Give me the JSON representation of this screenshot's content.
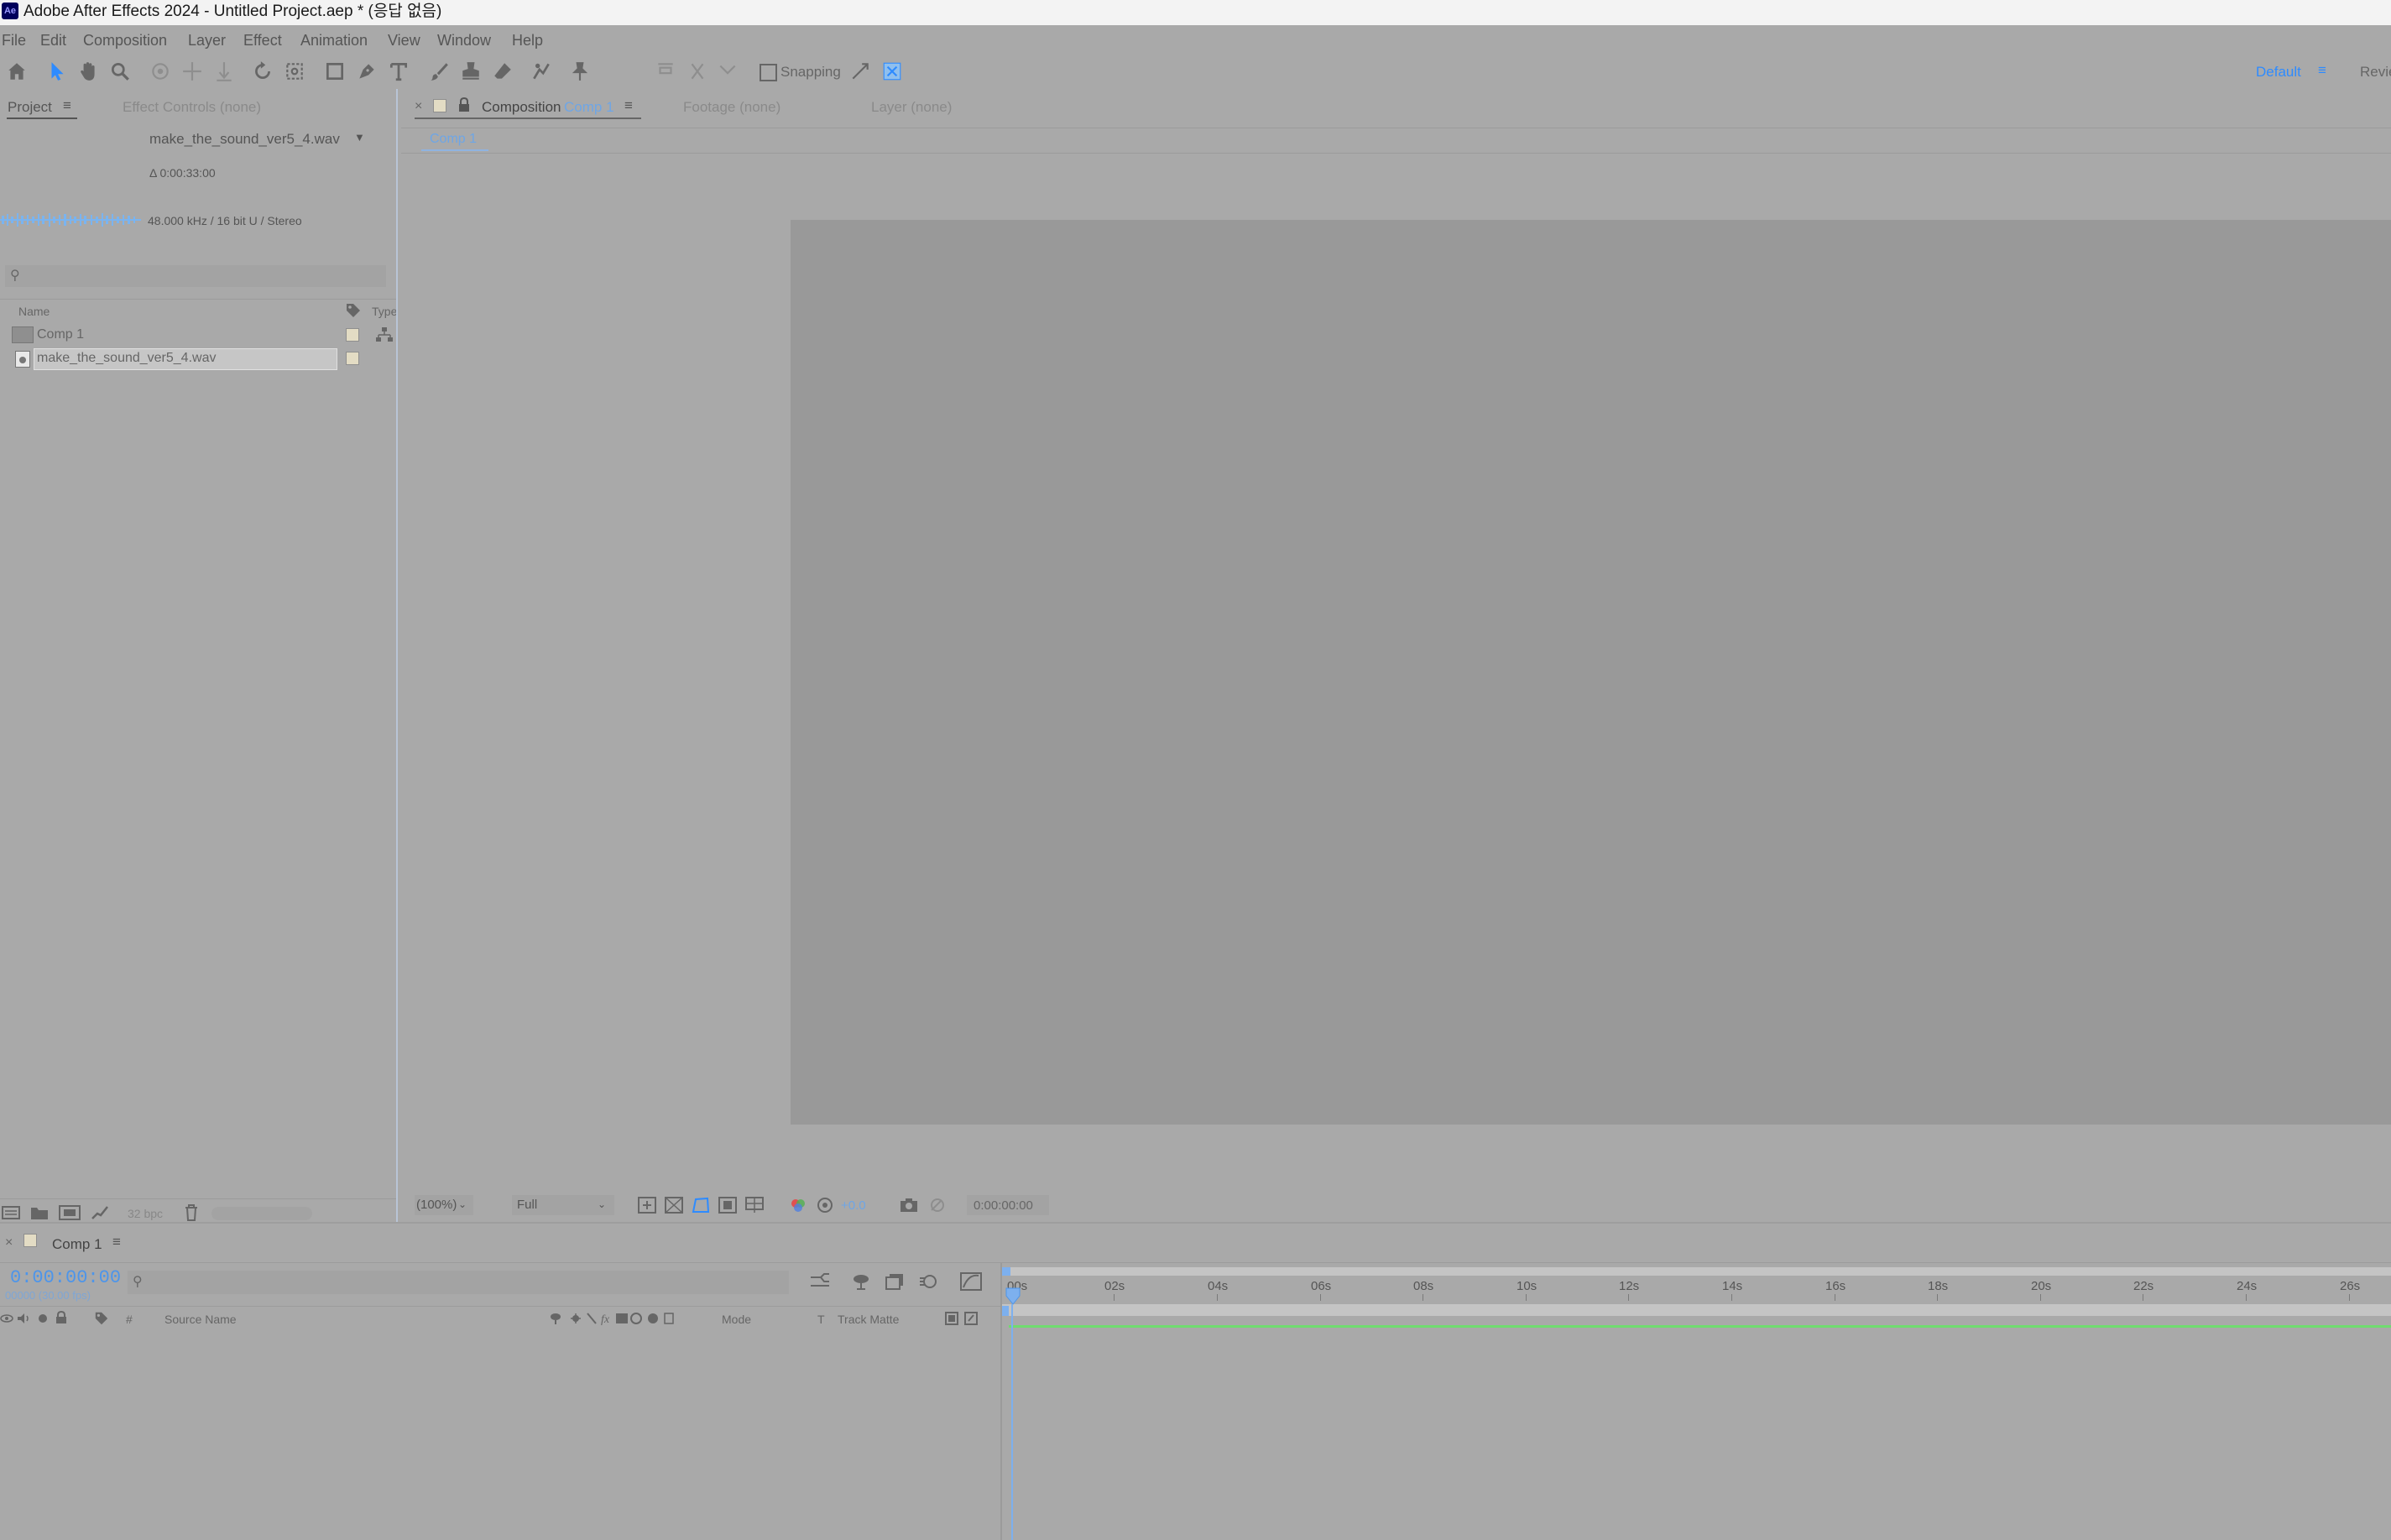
{
  "window": {
    "title": "Adobe After Effects 2024 - Untitled Project.aep * (응답 없음)",
    "app_icon_text": "Ae"
  },
  "menu": [
    "File",
    "Edit",
    "Composition",
    "Layer",
    "Effect",
    "Animation",
    "View",
    "Window",
    "Help"
  ],
  "toolbar": {
    "snapping_label": "Snapping",
    "workspace_label": "Default",
    "workspace_next": "Revie",
    "tools": [
      "home-icon",
      "selection-tool-icon",
      "hand-tool-icon",
      "zoom-tool-icon",
      "orbit-camera-icon",
      "pan-camera-icon",
      "dolly-camera-icon",
      "rotation-tool-icon",
      "anchor-point-tool-icon",
      "rectangle-tool-icon",
      "pen-tool-icon",
      "type-tool-icon",
      "brush-tool-icon",
      "clone-stamp-icon",
      "eraser-tool-icon",
      "roto-brush-icon",
      "puppet-pin-icon"
    ]
  },
  "project_panel": {
    "tab_project": "Project",
    "tab_effect_controls": "Effect Controls (none)",
    "preview_name": "make_the_sound_ver5_4.wav",
    "preview_duration": "Δ 0:00:33:00",
    "preview_audio_info": "48.000 kHz / 16 bit U / Stereo",
    "col_name": "Name",
    "col_type": "Type",
    "items": [
      {
        "name": "Comp 1",
        "icon": "composition-icon"
      },
      {
        "name": "make_the_sound_ver5_4.wav",
        "icon": "audio-file-icon"
      }
    ],
    "bpc_label": "32 bpc"
  },
  "comp_panel": {
    "tab_composition": "Composition",
    "tab_comp_name": "Comp 1",
    "tab_footage": "Footage (none)",
    "tab_layer": "Layer (none)",
    "breadcrumb": "Comp 1",
    "zoom": "(100%)",
    "resolution": "Full",
    "exposure": "+0.0",
    "timecode": "0:00:00:00",
    "canvas_color": "#999999"
  },
  "timeline": {
    "tab_name": "Comp 1",
    "current_time": "0:00:00:00",
    "frame_info": "00000 (30.00 fps)",
    "col_source_name": "Source Name",
    "col_number": "#",
    "col_mode": "Mode",
    "col_t": "T",
    "col_track_matte": "Track Matte",
    "ruler_labels": [
      "00s",
      "02s",
      "04s",
      "06s",
      "08s",
      "10s",
      "12s",
      "14s",
      "16s",
      "18s",
      "20s",
      "22s",
      "24s",
      "26s"
    ],
    "work_area_color": "#6fdc6f"
  }
}
